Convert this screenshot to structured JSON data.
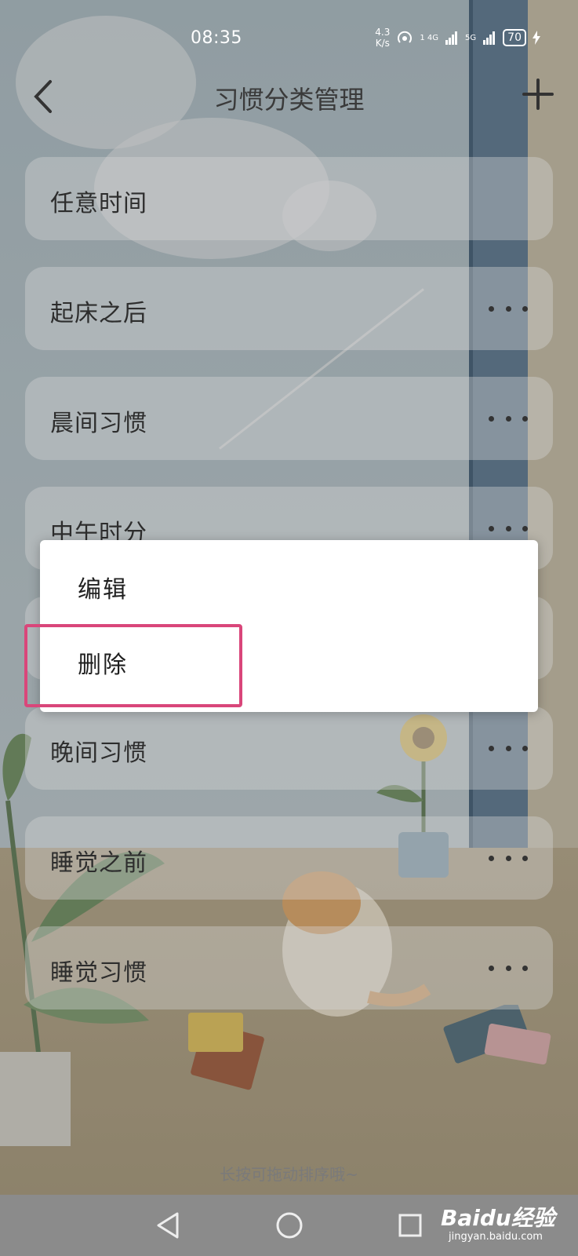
{
  "status_bar": {
    "time": "08:35",
    "net_speed_value": "4.3",
    "net_speed_unit": "K/s",
    "signal1": "1 4G",
    "signal2": "5G",
    "battery": "70"
  },
  "header": {
    "title": "习惯分类管理",
    "back_icon": "chevron-left-icon",
    "add_icon": "plus-icon"
  },
  "categories": [
    {
      "label": "任意时间",
      "has_more": false
    },
    {
      "label": "起床之后",
      "has_more": true
    },
    {
      "label": "晨间习惯",
      "has_more": true
    },
    {
      "label": "中午时分",
      "has_more": true
    },
    {
      "label": "",
      "has_more": true
    },
    {
      "label": "晚间习惯",
      "has_more": true
    },
    {
      "label": "睡觉之前",
      "has_more": true
    },
    {
      "label": "睡觉习惯",
      "has_more": true
    }
  ],
  "context_menu": {
    "edit": "编辑",
    "delete": "删除",
    "highlight_color": "#d9467a"
  },
  "hint": "长按可拖动排序哦~",
  "watermark": {
    "main": "Baidu经验",
    "sub": "jingyan.baidu.com"
  },
  "nav_bar": {
    "icons": [
      "back-triangle-icon",
      "home-circle-icon",
      "recents-square-icon"
    ]
  }
}
